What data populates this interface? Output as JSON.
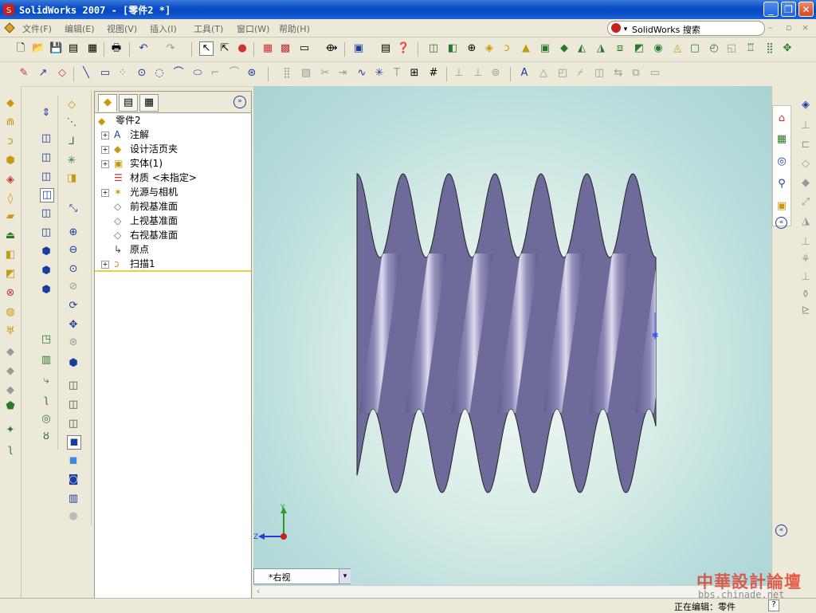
{
  "window": {
    "title": "SolidWorks 2007 - [零件2 *]"
  },
  "menu": {
    "items": [
      "文件(F)",
      "编辑(E)",
      "视图(V)",
      "插入(I)",
      "工具(T)",
      "窗口(W)",
      "帮助(H)"
    ],
    "search_label": "SolidWorks 搜索"
  },
  "tree": {
    "root": "零件2",
    "items": [
      {
        "label": "注解",
        "icon": "annotation-icon",
        "expandable": true
      },
      {
        "label": "设计活页夹",
        "icon": "design-binder-icon",
        "expandable": true
      },
      {
        "label": "实体(1)",
        "icon": "solid-body-icon",
        "expandable": true
      },
      {
        "label": "材质 <未指定>",
        "icon": "material-icon",
        "expandable": false
      },
      {
        "label": "光源与相机",
        "icon": "lights-camera-icon",
        "expandable": true
      },
      {
        "label": "前视基准面",
        "icon": "plane-icon",
        "expandable": false
      },
      {
        "label": "上视基准面",
        "icon": "plane-icon",
        "expandable": false
      },
      {
        "label": "右视基准面",
        "icon": "plane-icon",
        "expandable": false
      },
      {
        "label": "原点",
        "icon": "origin-icon",
        "expandable": false
      },
      {
        "label": "扫描1",
        "icon": "sweep-feature-icon",
        "expandable": true
      }
    ]
  },
  "view": {
    "current": "*右视"
  },
  "triad": {
    "y": "Y",
    "z": "Z"
  },
  "status": {
    "editing": "正在编辑：零件",
    "help": "?"
  },
  "watermark": {
    "main": "中華設計論壇",
    "url": "bbs.chinade.net"
  },
  "colors": {
    "accent": "#0a4ec9",
    "part": "#6e6a9a",
    "highlight": "#ffff80",
    "selection": "#d7d3b3"
  }
}
